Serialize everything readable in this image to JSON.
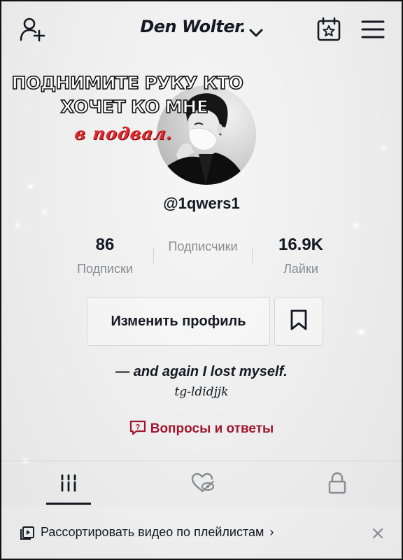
{
  "header": {
    "username": "Den Wolter.",
    "icons": {
      "add_user": "add-user-icon",
      "dropdown": "chevron-down-icon",
      "calendar": "calendar-star-icon",
      "menu": "hamburger-menu-icon"
    }
  },
  "banner": {
    "line1": "Поднимите руку кто",
    "line2": "хочет ко мне",
    "line3": "в подвал."
  },
  "profile": {
    "handle": "@1qwers1",
    "stats": [
      {
        "value": "86",
        "label": "Подписки"
      },
      {
        "value": "",
        "label": "Подписчики"
      },
      {
        "value": "16.9K",
        "label": "Лайки"
      }
    ],
    "edit_button": "Изменить профиль",
    "bio_line1": "— and again I lost myself.",
    "bio_line2": "tg-ldidjjk",
    "qa_label": "Вопросы и ответы"
  },
  "tabs": [
    {
      "icon": "grid-videos-icon"
    },
    {
      "icon": "liked-hidden-icon"
    },
    {
      "icon": "lock-icon"
    }
  ],
  "playlist_bar": {
    "text": "Рассортировать видео по плейлистам",
    "arrow": "›"
  },
  "colors": {
    "accent_red": "#a01830",
    "banner_red": "#e0282f",
    "text": "#161823",
    "muted": "#8a8b91"
  }
}
